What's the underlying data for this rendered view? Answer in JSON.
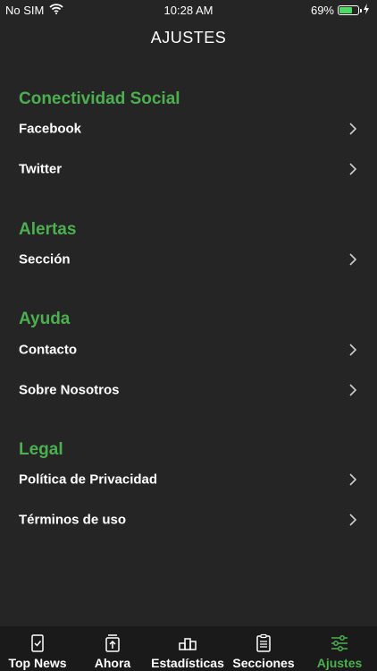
{
  "status": {
    "carrier": "No SIM",
    "time": "10:28 AM",
    "battery": "69%",
    "battery_level": 0.69
  },
  "nav": {
    "title": "AJUSTES"
  },
  "sections": [
    {
      "header": "Conectividad Social",
      "items": [
        "Facebook",
        "Twitter"
      ]
    },
    {
      "header": "Alertas",
      "items": [
        "Sección"
      ]
    },
    {
      "header": "Ayuda",
      "items": [
        "Contacto",
        "Sobre Nosotros"
      ]
    },
    {
      "header": "Legal",
      "items": [
        "Política de Privacidad",
        "Términos de uso"
      ]
    }
  ],
  "tabs": [
    {
      "label": "Top News",
      "icon": "checklist-icon"
    },
    {
      "label": "Ahora",
      "icon": "upload-box-icon"
    },
    {
      "label": "Estadísticas",
      "icon": "podium-icon"
    },
    {
      "label": "Secciones",
      "icon": "clipboard-icon"
    },
    {
      "label": "Ajustes",
      "icon": "sliders-icon",
      "active": true
    }
  ],
  "colors": {
    "accent": "#4caf50",
    "background": "#252525",
    "tabbar": "#1a1a1a"
  }
}
